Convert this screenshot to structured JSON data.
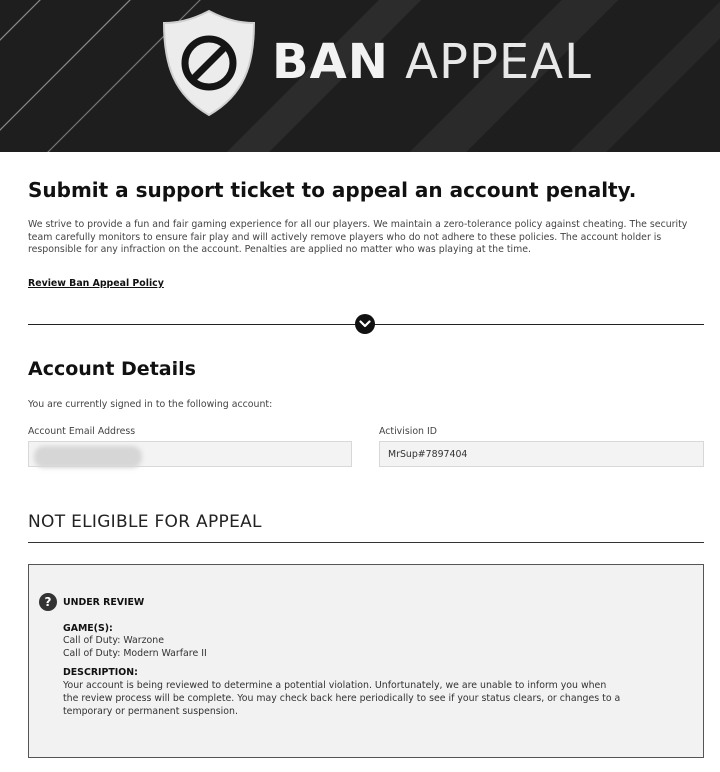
{
  "banner": {
    "title_bold": "BAN",
    "title_light": "APPEAL",
    "logo_icon": "shield-ban-icon"
  },
  "main": {
    "title": "Submit a support ticket to appeal an account penalty.",
    "intro": "We strive to provide a fun and fair gaming experience for all our players. We maintain a zero-tolerance policy against cheating. The security team carefully monitors to ensure fair play and will actively remove players who do not adhere to these policies. The account holder is responsible for any infraction on the account. Penalties are applied no matter who was playing at the time.",
    "policy_link": "Review Ban Appeal Policy",
    "divider_icon": "chevron-down-icon"
  },
  "account": {
    "section_title": "Account Details",
    "signed_in_text": "You are currently signed in to the following account:",
    "email_label": "Account Email Address",
    "email_value": "",
    "activision_label": "Activision ID",
    "activision_value": "MrSup#7897404"
  },
  "eligibility": {
    "heading": "NOT ELIGIBLE FOR APPEAL",
    "status_icon": "question-circle-icon",
    "status_title": "UNDER REVIEW",
    "games_label": "GAME(S):",
    "games": [
      "Call of Duty: Warzone",
      "Call of Duty: Modern Warfare II"
    ],
    "description_label": "DESCRIPTION:",
    "description": "Your account is being reviewed to determine a potential violation. Unfortunately, we are unable to inform you when the review process will be complete. You may check back here periodically to see if your status clears, or changes to a temporary or permanent suspension."
  },
  "colors": {
    "banner_bg": "#1e1e1e",
    "box_bg": "#f2f2f2",
    "text": "#222222"
  }
}
